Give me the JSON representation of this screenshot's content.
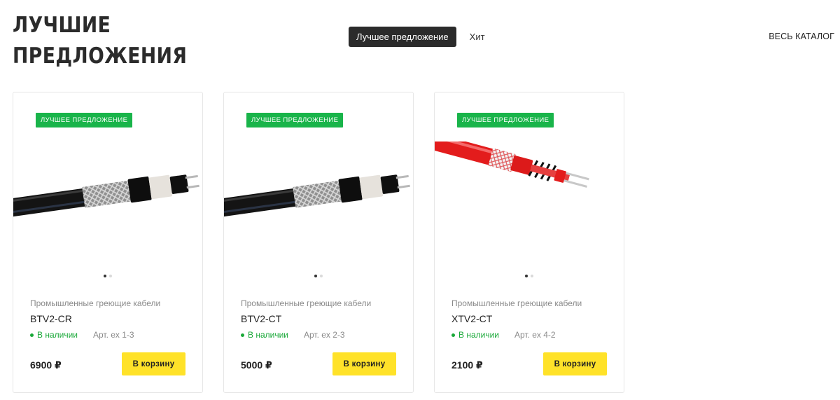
{
  "section": {
    "title_line1": "ЛУЧШИЕ",
    "title_line2": "ПРЕДЛОЖЕНИЯ"
  },
  "tabs": [
    {
      "label": "Лучшее предложение",
      "active": true
    },
    {
      "label": "Хит",
      "active": false
    }
  ],
  "catalog_link": "ВЕСЬ КАТАЛОГ",
  "colors": {
    "badge": "#19b44a",
    "stock": "#19a838",
    "cart_button": "#ffe229",
    "active_tab": "#2b2b2b"
  },
  "products": [
    {
      "badge": "ЛУЧШЕЕ ПРЕДЛОЖЕНИЕ",
      "image": "black-heating-cable",
      "category": "Промышленные греющие кабели",
      "name": "BTV2-CR",
      "stock": "В наличии",
      "sku": "Арт. ex 1-3",
      "price": "6900 ₽",
      "cart_label": "В корзину",
      "slides": 2,
      "active_slide": 0
    },
    {
      "badge": "ЛУЧШЕЕ ПРЕДЛОЖЕНИЕ",
      "image": "black-heating-cable",
      "category": "Промышленные греющие кабели",
      "name": "BTV2-CT",
      "stock": "В наличии",
      "sku": "Арт. ex 2-3",
      "price": "5000 ₽",
      "cart_label": "В корзину",
      "slides": 2,
      "active_slide": 0
    },
    {
      "badge": "ЛУЧШЕЕ ПРЕДЛОЖЕНИЕ",
      "image": "red-heating-cable",
      "category": "Промышленные греющие кабели",
      "name": "XTV2-CT",
      "stock": "В наличии",
      "sku": "Арт. ex 4-2",
      "price": "2100 ₽",
      "cart_label": "В корзину",
      "slides": 2,
      "active_slide": 0
    }
  ]
}
